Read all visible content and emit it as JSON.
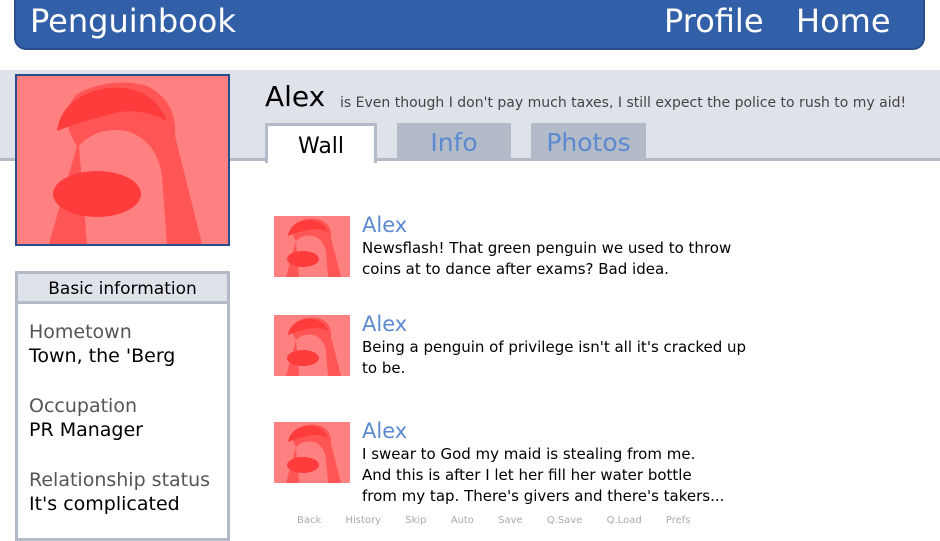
{
  "topbar": {
    "brand": "Penguinbook",
    "nav": {
      "profile": "Profile",
      "home": "Home"
    }
  },
  "profile": {
    "name": "Alex",
    "status": "is Even though I don't pay much taxes, I still expect the police to rush to my aid!"
  },
  "tabs": {
    "wall": "Wall",
    "info": "Info",
    "photos": "Photos"
  },
  "basic_info": {
    "title": "Basic information",
    "fields": [
      {
        "label": "Hometown",
        "value": "Town, the 'Berg"
      },
      {
        "label": "Occupation",
        "value": "PR Manager"
      },
      {
        "label": "Relationship status",
        "value": "It's complicated"
      }
    ]
  },
  "posts": [
    {
      "author": "Alex",
      "lines": [
        "Newsflash! That green penguin we used to throw",
        "coins at to dance after exams? Bad idea."
      ]
    },
    {
      "author": "Alex",
      "lines": [
        "Being a penguin of privilege isn't all it's cracked up",
        "to be."
      ]
    },
    {
      "author": "Alex",
      "lines": [
        "I swear to God my maid is stealing from me.",
        "And this is after I let her fill her water bottle",
        "from my tap. There's givers and there's takers..."
      ]
    }
  ],
  "quick_menu": [
    "Back",
    "History",
    "Skip",
    "Auto",
    "Save",
    "Q.Save",
    "Q.Load",
    "Prefs"
  ],
  "colors": {
    "brand_blue": "#3260a8",
    "link_blue": "#5b8ad0",
    "avatar_bg": "#ff8080",
    "avatar_fg": "#ff3c3c"
  }
}
